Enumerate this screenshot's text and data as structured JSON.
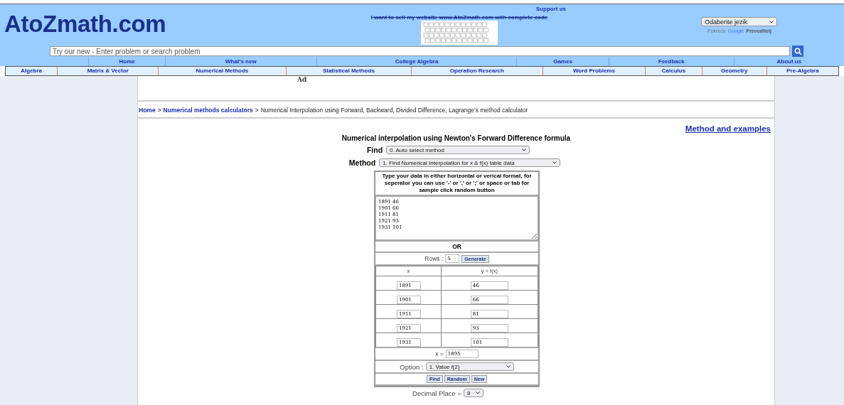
{
  "header": {
    "logo": "AtoZmath.com",
    "support_link": "Support us",
    "sale_notice": "I want to sell my website www.AtoZmath.com with complete code",
    "language_select": {
      "value": "Odaberite jezik"
    },
    "translate_credit": {
      "prefix": "Pokreće",
      "brand": "Google",
      "service": "Prevoditelj"
    },
    "search": {
      "placeholder": "Try our new - Enter problem or search problem"
    }
  },
  "nav_primary": [
    "Home",
    "What's new",
    "College Algebra",
    "Games",
    "Feedback",
    "About us"
  ],
  "nav_secondary": [
    "Algebra",
    "Matrix & Vector",
    "Numerical Methods",
    "Statistical Methods",
    "Operation Research",
    "Word Problems",
    "Calculus",
    "Geometry",
    "Pre-Algebra"
  ],
  "ad_label": "Ad",
  "breadcrumb": {
    "separator": ">",
    "links": [
      "Home",
      "Numerical methods calculators"
    ],
    "current": "Numerical Interpolation using Forward, Backward, Divided Difference, Lagrange's method calculator"
  },
  "method_link": "Method and examples",
  "calculator": {
    "title": "Numerical interpolation using Newton's Forward Difference formula",
    "find": {
      "label": "Find",
      "value": "0. Auto select method"
    },
    "method": {
      "label": "Method",
      "value": "1. Find Numerical Interpolation for x & f(x) table data"
    },
    "instructions": "Type your data in either horizontal or verical format, for seperator you can use '-' or ',' or ';' or space or tab for sample click random button",
    "data_text": "1891 46\n1901 66\n1911 81\n1921 93\n1931 101",
    "or_label": "OR",
    "rows_label": "Rows :",
    "rows_value": "5",
    "generate_button": "Generate",
    "columns": [
      "x",
      "y = f(x)"
    ],
    "rows": [
      [
        "1891",
        "46"
      ],
      [
        "1901",
        "66"
      ],
      [
        "1911",
        "81"
      ],
      [
        "1921",
        "93"
      ],
      [
        "1931",
        "101"
      ]
    ],
    "x_label": "x =",
    "x_value": "1895",
    "option_label": "Option :",
    "option_value": "1. Value f(2)",
    "buttons": [
      "Find",
      "Random",
      "New"
    ],
    "decimal_label": "Decimal Place =",
    "decimal_value": "8"
  }
}
